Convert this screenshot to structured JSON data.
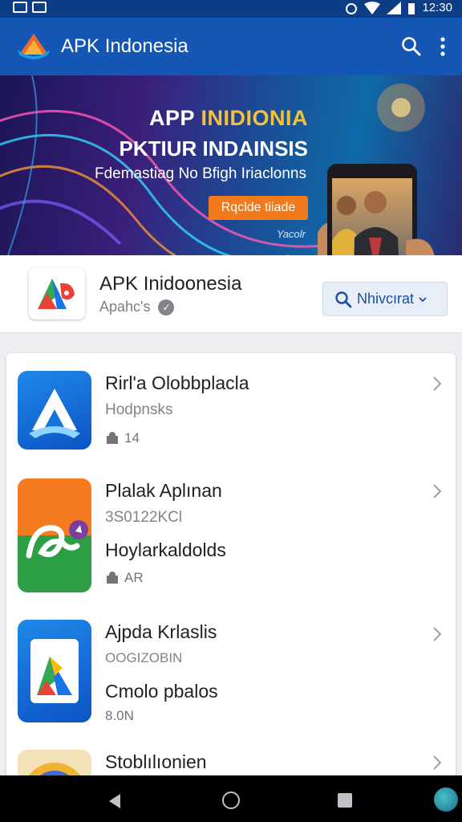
{
  "status_bar": {
    "time": "12:30"
  },
  "app_bar": {
    "title": "APK Indonesia"
  },
  "banner": {
    "headline_white": "APP ",
    "headline_yellow": "INIDIONIA",
    "headline2": "PKTIUR INDAINSIS",
    "subtitle": "Fdemastiag No Bfigh Iriaclonns",
    "button_label": "Rqclde tiiade",
    "footer": "Yacolr"
  },
  "app_header": {
    "title": "APK Inidoonesia",
    "subtitle": "Apahc's",
    "button_label": "Nhivcırat"
  },
  "items": [
    {
      "title": "Rirl'a Olobbplacla",
      "subtitle": "Hodpnsks",
      "meta": "14"
    },
    {
      "title": "Plalak Aplınan",
      "subtitle": "3S0122KCl",
      "big": "Hoylarkaldolds",
      "meta": "AR"
    },
    {
      "title": "Ajpda Krlaslis",
      "subtitle": "OOGIZOBIN",
      "big": "Cmolo pbalos",
      "meta": "8.0N"
    },
    {
      "title": "Stoblılıonien"
    }
  ],
  "colors": {
    "app_bar": "#1356b3",
    "status_bar": "#0d3d85",
    "banner_button": "#f07a1c",
    "accent_text": "#174ea6"
  }
}
